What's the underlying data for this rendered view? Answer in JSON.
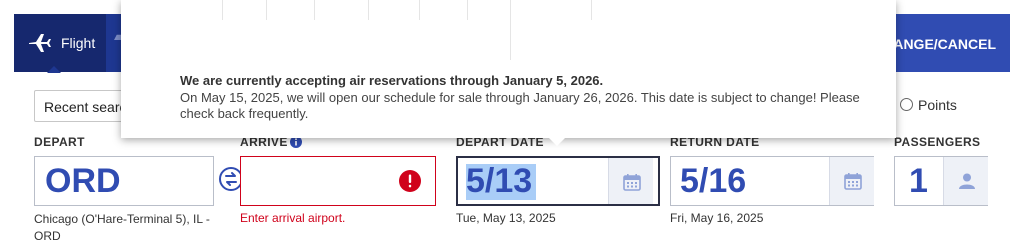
{
  "nav": {
    "flight_label": "Flight",
    "manage_label": "ANGE/CANCEL"
  },
  "recent_search": {
    "label": "Recent searc"
  },
  "points": {
    "label": "Points"
  },
  "tooltip": {
    "line1": "We are currently accepting air reservations through January 5, 2026.",
    "line2": "On May 15, 2025, we will open our schedule for sale through January 26, 2026. This date is subject to change! Please check back frequently."
  },
  "depart": {
    "label": "DEPART",
    "value": "ORD",
    "sub": "Chicago (O'Hare-Terminal 5), IL - ORD"
  },
  "arrive": {
    "label": "ARRIVE",
    "value": "",
    "error": "Enter arrival airport."
  },
  "depart_date": {
    "label": "DEPART DATE",
    "value": "5/13",
    "sub": "Tue, May 13, 2025"
  },
  "return_date": {
    "label": "RETURN DATE",
    "value": "5/16",
    "sub": "Fri, May 16, 2025"
  },
  "passengers": {
    "label": "PASSENGERS",
    "value": "1"
  },
  "colors": {
    "nav_bg": "#1e3791",
    "accent_blue": "#304cb2",
    "error_red": "#d0021b",
    "selection": "#a9cdf7"
  },
  "icons": [
    "plane-icon",
    "swap-icon",
    "error-icon",
    "info-icon",
    "calendar-icon",
    "person-icon",
    "radio-icon"
  ]
}
